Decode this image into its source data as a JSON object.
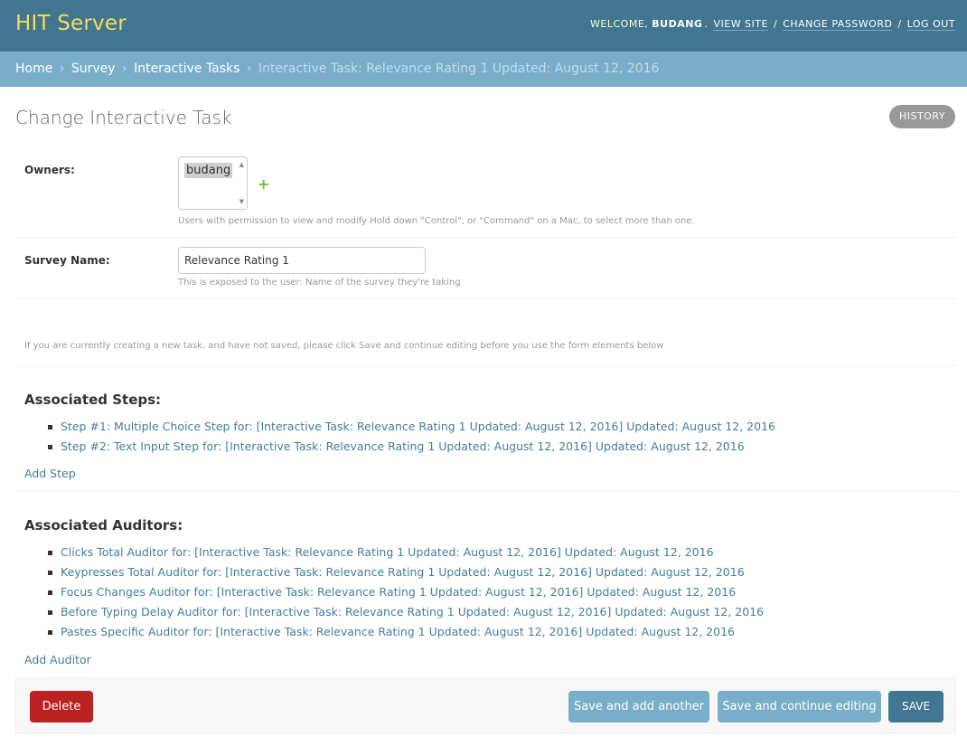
{
  "header": {
    "site_title": "HIT Server",
    "welcome": "WELCOME,",
    "username": "BUDANG",
    "links": [
      "VIEW SITE",
      "CHANGE PASSWORD",
      "LOG OUT"
    ]
  },
  "breadcrumbs": {
    "items": [
      "Home",
      "Survey",
      "Interactive Tasks"
    ],
    "current": "Interactive Task: Relevance Rating 1 Updated: August 12, 2016",
    "separator": "›"
  },
  "page": {
    "title": "Change Interactive Task",
    "history_label": "HISTORY"
  },
  "form": {
    "owners": {
      "label": "Owners:",
      "options": [
        "budang"
      ],
      "selected": "budang",
      "add_icon": "+",
      "help": "Users with permission to view and modify Hold down \"Control\", or \"Command\" on a Mac, to select more than one."
    },
    "survey_name": {
      "label": "Survey Name:",
      "value": "Relevance Rating 1",
      "help": "This is exposed to the user: Name of the survey they're taking"
    },
    "notice": "If you are currently creating a new task, and have not saved, please click Save and continue editing before you use the form elements below"
  },
  "steps": {
    "title": "Associated Steps:",
    "items": [
      "Step #1: Multiple Choice Step for: [Interactive Task: Relevance Rating 1 Updated: August 12, 2016] Updated: August 12, 2016",
      "Step #2: Text Input Step for: [Interactive Task: Relevance Rating 1 Updated: August 12, 2016] Updated: August 12, 2016"
    ],
    "add_label": "Add Step"
  },
  "auditors": {
    "title": "Associated Auditors:",
    "items": [
      "Clicks Total Auditor for: [Interactive Task: Relevance Rating 1 Updated: August 12, 2016] Updated: August 12, 2016",
      "Keypresses Total Auditor for: [Interactive Task: Relevance Rating 1 Updated: August 12, 2016] Updated: August 12, 2016",
      "Focus Changes Auditor for: [Interactive Task: Relevance Rating 1 Updated: August 12, 2016] Updated: August 12, 2016",
      "Before Typing Delay Auditor for: [Interactive Task: Relevance Rating 1 Updated: August 12, 2016] Updated: August 12, 2016",
      "Pastes Specific Auditor for: [Interactive Task: Relevance Rating 1 Updated: August 12, 2016] Updated: August 12, 2016"
    ],
    "add_label": "Add Auditor"
  },
  "submit_row": {
    "delete_label": "Delete",
    "save_add_another_label": "Save and add another",
    "save_continue_label": "Save and continue editing",
    "save_label": "SAVE"
  },
  "colors": {
    "header_bg": "#417690",
    "breadcrumbs_bg": "#79aec8",
    "site_title": "#f5dd5d",
    "link": "#447e9b",
    "delete": "#ba2121",
    "add_icon": "#70bf2b"
  }
}
